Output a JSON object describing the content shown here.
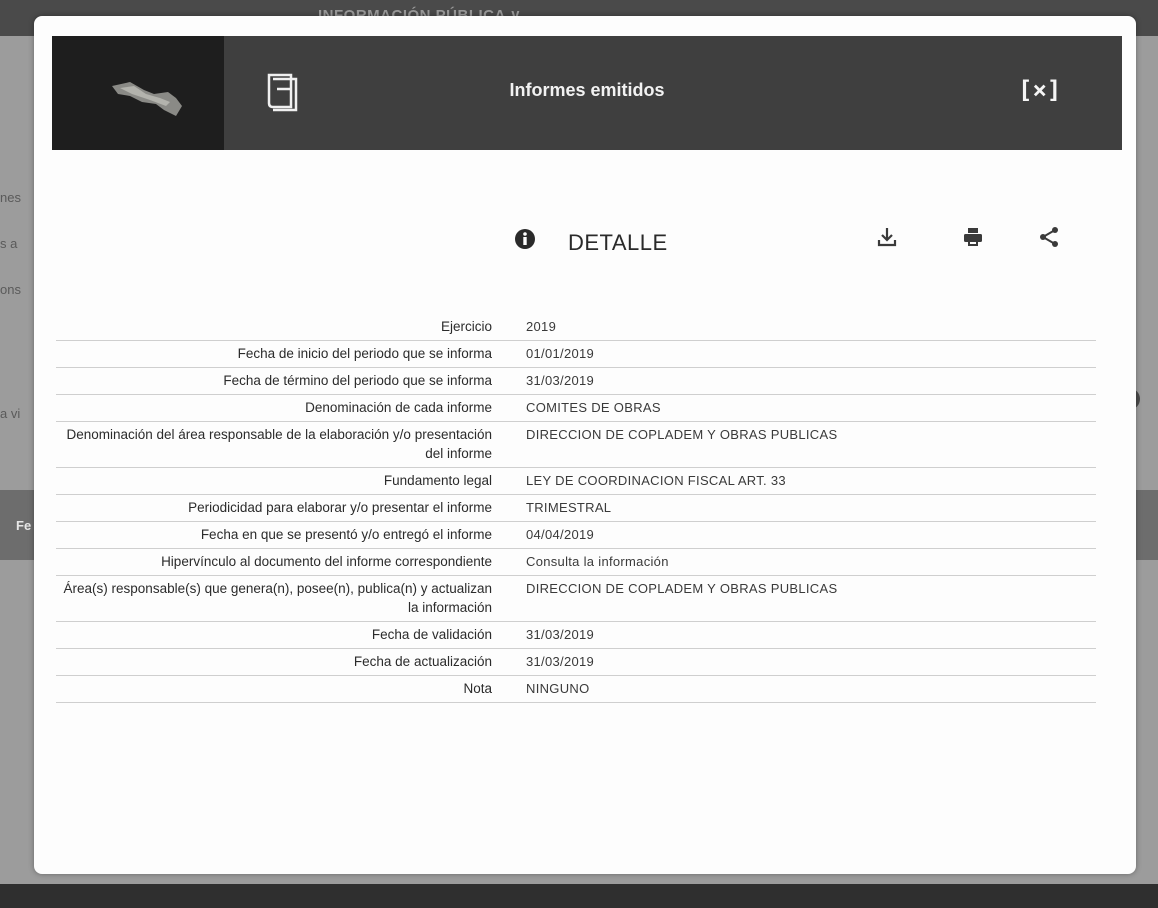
{
  "background": {
    "top_menu": "INFORMACIÓN PÚBLICA ∨",
    "fragments": [
      "nes",
      "s a",
      "ons",
      "a vi",
      "Fe"
    ],
    "badge": "AR"
  },
  "modal": {
    "title": "Informes emitidos",
    "close_label": "[×]",
    "icons": {
      "logo": "mexico-map-logo",
      "book": "book-icon",
      "info": "info-circle-icon",
      "download": "download-icon",
      "print": "print-icon",
      "share": "share-icon"
    },
    "section_title": "DETALLE",
    "rows": [
      {
        "label": "Ejercicio",
        "value": "2019"
      },
      {
        "label": "Fecha de inicio del periodo que se informa",
        "value": "01/01/2019"
      },
      {
        "label": "Fecha de término del periodo que se informa",
        "value": "31/03/2019"
      },
      {
        "label": "Denominación de cada informe",
        "value": "COMITES DE OBRAS"
      },
      {
        "label": "Denominación del área responsable de la elaboración y/o presentación del informe",
        "value": "DIRECCION DE COPLADEM Y OBRAS PUBLICAS"
      },
      {
        "label": "Fundamento legal",
        "value": "LEY DE COORDINACION FISCAL ART. 33"
      },
      {
        "label": "Periodicidad para elaborar y/o presentar el informe",
        "value": "TRIMESTRAL"
      },
      {
        "label": "Fecha en que se presentó y/o entregó el informe",
        "value": "04/04/2019"
      },
      {
        "label": "Hipervínculo al documento del informe correspondiente",
        "value": "Consulta la información"
      },
      {
        "label": "Área(s) responsable(s) que genera(n), posee(n), publica(n) y actualizan la información",
        "value": "DIRECCION DE COPLADEM Y OBRAS PUBLICAS"
      },
      {
        "label": "Fecha de validación",
        "value": "31/03/2019"
      },
      {
        "label": "Fecha de actualización",
        "value": "31/03/2019"
      },
      {
        "label": "Nota",
        "value": "NINGUNO"
      }
    ]
  }
}
